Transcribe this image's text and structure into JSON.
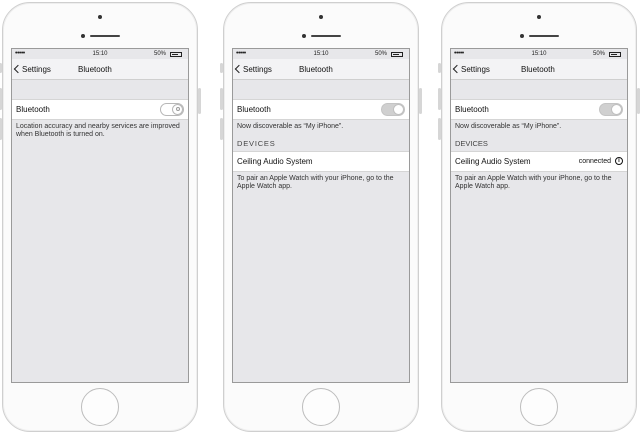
{
  "status": {
    "dots": "•••••",
    "time": "15:10",
    "battery": "50%"
  },
  "nav": {
    "back_label": "Settings",
    "title": "Bluetooth"
  },
  "screen1": {
    "bluetooth_label": "Bluetooth",
    "bluetooth_on": false,
    "note": "Location accuracy and nearby services are improved when Bluetooth is turned on."
  },
  "screen2": {
    "bluetooth_label": "Bluetooth",
    "bluetooth_on": true,
    "discoverable": "Now discoverable as “My iPhone”.",
    "devices_header": "DEVICES",
    "device_name": "Ceiling Audio System",
    "pair_note": "To pair an Apple Watch with your iPhone, go to the Apple Watch app."
  },
  "screen3": {
    "bluetooth_label": "Bluetooth",
    "bluetooth_on": true,
    "discoverable": "Now discoverable as “My iPhone”.",
    "devices_header": "DEVICES",
    "device_name": "Ceiling Audio System",
    "device_status": "connected",
    "info_glyph": "i",
    "pair_note": "To pair an Apple Watch with your iPhone, go to the Apple Watch app."
  },
  "icons": {
    "back": "chevron-left-icon",
    "info": "info-icon",
    "battery": "battery-icon"
  }
}
